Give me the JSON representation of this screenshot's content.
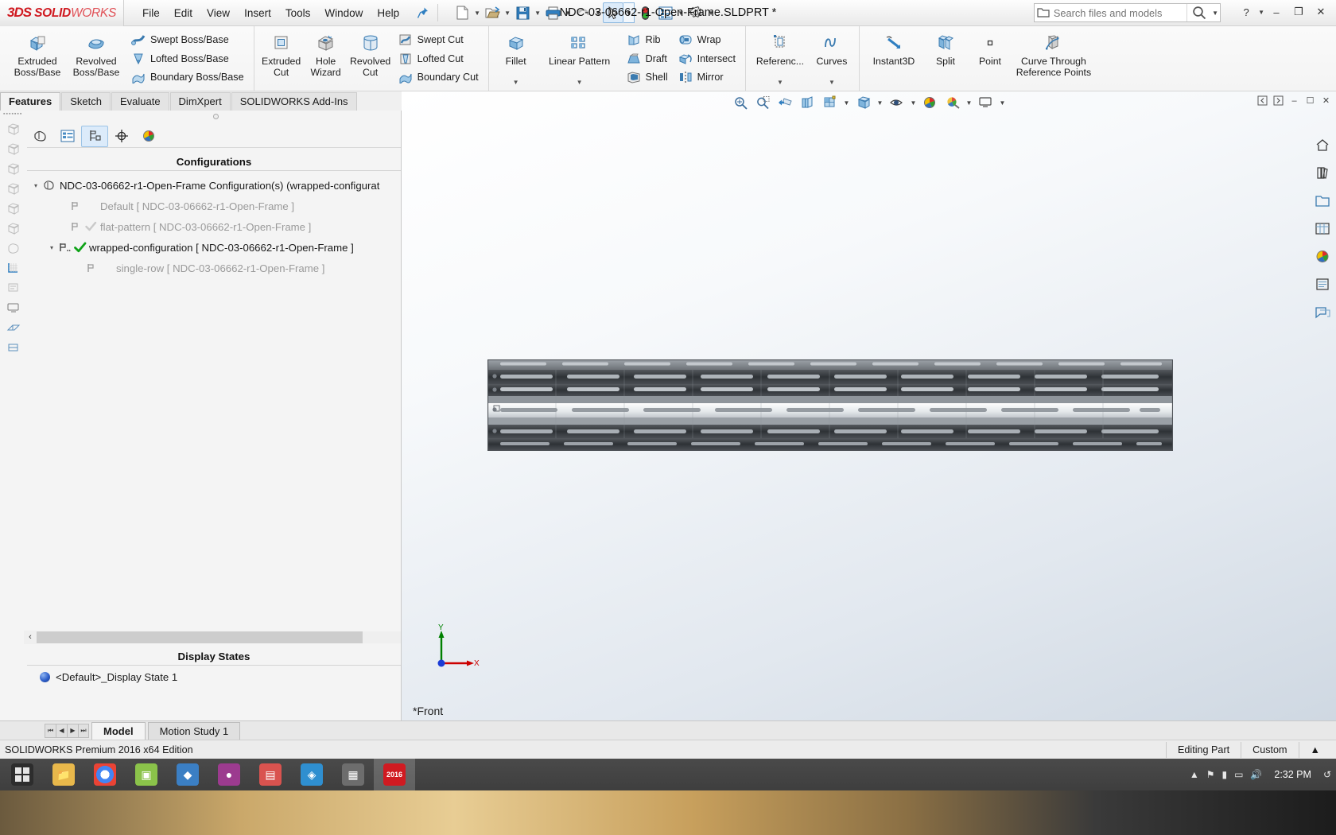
{
  "titlebar": {
    "logo_ds": "3DS",
    "logo_solid": "SOLID",
    "logo_works": "WORKS",
    "menu": [
      "File",
      "Edit",
      "View",
      "Insert",
      "Tools",
      "Window",
      "Help"
    ],
    "document_title": "NDC-03-06662-r1-Open-Frame.SLDPRT *",
    "quick_access": [
      {
        "name": "pin-icon",
        "label": "Pin"
      },
      {
        "name": "new-document-icon",
        "label": "New"
      },
      {
        "name": "open-document-icon",
        "label": "Open"
      },
      {
        "name": "save-icon",
        "label": "Save"
      },
      {
        "name": "print-icon",
        "label": "Print"
      },
      {
        "name": "undo-icon",
        "label": "Undo"
      },
      {
        "name": "select-cursor-icon",
        "label": "Select"
      },
      {
        "name": "rebuild-icon",
        "label": "Rebuild"
      },
      {
        "name": "options-list-icon",
        "label": "File Properties"
      },
      {
        "name": "gear-icon",
        "label": "Options"
      }
    ],
    "search": {
      "placeholder": "Search files and models",
      "folder_icon": "folder-icon",
      "go_icon": "search-icon"
    },
    "window_controls": {
      "help": "?",
      "minimize": "–",
      "restore": "❐",
      "close": "✕"
    }
  },
  "ribbon": {
    "groups": [
      {
        "name": "boss-base",
        "big": [
          {
            "label": "Extruded\nBoss/Base",
            "icon": "extruded-boss-icon"
          },
          {
            "label": "Revolved\nBoss/Base",
            "icon": "revolved-boss-icon"
          }
        ],
        "small": [
          {
            "label": "Swept Boss/Base",
            "icon": "swept-boss-icon"
          },
          {
            "label": "Lofted Boss/Base",
            "icon": "lofted-boss-icon"
          },
          {
            "label": "Boundary Boss/Base",
            "icon": "boundary-boss-icon"
          }
        ]
      },
      {
        "name": "cut",
        "big": [
          {
            "label": "Extruded\nCut",
            "icon": "extruded-cut-icon"
          },
          {
            "label": "Hole\nWizard",
            "icon": "hole-wizard-icon"
          },
          {
            "label": "Revolved\nCut",
            "icon": "revolved-cut-icon"
          }
        ],
        "small": [
          {
            "label": "Swept Cut",
            "icon": "swept-cut-icon"
          },
          {
            "label": "Lofted Cut",
            "icon": "lofted-cut-icon"
          },
          {
            "label": "Boundary Cut",
            "icon": "boundary-cut-icon"
          }
        ]
      },
      {
        "name": "fillet-pattern",
        "big": [
          {
            "label": "Fillet",
            "icon": "fillet-icon",
            "caret": true
          },
          {
            "label": "Linear Pattern",
            "icon": "linear-pattern-icon",
            "caret": true
          }
        ],
        "small": [
          {
            "label": "Rib",
            "icon": "rib-icon"
          },
          {
            "label": "Draft",
            "icon": "draft-icon"
          },
          {
            "label": "Shell",
            "icon": "shell-icon"
          }
        ],
        "small2": [
          {
            "label": "Wrap",
            "icon": "wrap-icon"
          },
          {
            "label": "Intersect",
            "icon": "intersect-icon"
          },
          {
            "label": "Mirror",
            "icon": "mirror-icon"
          }
        ]
      },
      {
        "name": "reference-curves",
        "big": [
          {
            "label": "Referenc...",
            "icon": "reference-geometry-icon",
            "caret": true
          },
          {
            "label": "Curves",
            "icon": "curves-icon",
            "caret": true
          }
        ]
      },
      {
        "name": "instant3d",
        "big": [
          {
            "label": "Instant3D",
            "icon": "instant3d-icon"
          },
          {
            "label": "Split",
            "icon": "split-icon"
          },
          {
            "label": "Point",
            "icon": "point-icon"
          },
          {
            "label": "Curve Through\nReference Points",
            "icon": "curve-through-points-icon"
          }
        ]
      }
    ]
  },
  "command_tabs": [
    {
      "label": "Features",
      "active": true
    },
    {
      "label": "Sketch",
      "active": false
    },
    {
      "label": "Evaluate",
      "active": false
    },
    {
      "label": "DimXpert",
      "active": false
    },
    {
      "label": "SOLIDWORKS Add-Ins",
      "active": false
    }
  ],
  "feature_manager": {
    "toolbar_buttons": [
      {
        "name": "feature-manager-tree-tab",
        "active": false
      },
      {
        "name": "property-manager-tab",
        "active": false
      },
      {
        "name": "configuration-manager-tab",
        "active": true
      },
      {
        "name": "dimxpert-manager-tab",
        "active": false
      },
      {
        "name": "display-manager-tab",
        "active": false
      }
    ],
    "configurations_header": "Configurations",
    "tree": [
      {
        "label": "NDC-03-06662-r1-Open-Frame Configuration(s)  (wrapped-configurat",
        "indent": 0,
        "twist": "▾",
        "icon": "part-config-root-icon",
        "check": false,
        "dim": false
      },
      {
        "label": "Default [ NDC-03-06662-r1-Open-Frame ]",
        "indent": 1,
        "twist": "",
        "icon": "configuration-flag-icon",
        "check": false,
        "dim": true
      },
      {
        "label": "flat-pattern [ NDC-03-06662-r1-Open-Frame ]",
        "indent": 1,
        "twist": "",
        "icon": "configuration-flag-icon",
        "check": true,
        "check_dim": true,
        "dim": true
      },
      {
        "label": "wrapped-configuration [ NDC-03-06662-r1-Open-Frame ]",
        "indent": 1,
        "twist": "▾",
        "icon": "derived-configuration-icon",
        "check": true,
        "dim": false
      },
      {
        "label": "single-row [ NDC-03-06662-r1-Open-Frame ]",
        "indent": 2,
        "twist": "",
        "icon": "configuration-flag-icon",
        "check": false,
        "dim": true
      }
    ],
    "display_states_header": "Display States",
    "display_states": [
      {
        "label": "<Default>_Display State 1",
        "icon": "display-state-sphere-icon"
      }
    ],
    "scrollbar": {
      "left_arrow": "‹",
      "right_arrow": "›"
    }
  },
  "graphics": {
    "heads_up_toolbar": [
      {
        "name": "zoom-to-fit-icon"
      },
      {
        "name": "zoom-to-area-icon"
      },
      {
        "name": "previous-view-icon"
      },
      {
        "name": "section-view-icon"
      },
      {
        "name": "view-orientation-icon",
        "caret": true
      },
      {
        "name": "display-style-icon",
        "caret": true
      },
      {
        "name": "hide-show-items-icon",
        "caret": true
      },
      {
        "name": "edit-appearance-icon"
      },
      {
        "name": "apply-scene-icon",
        "caret": true
      },
      {
        "name": "view-settings-icon",
        "caret": true
      }
    ],
    "window_buttons": [
      {
        "name": "panel-collapse-left-icon"
      },
      {
        "name": "panel-expand-right-icon"
      },
      {
        "name": "minimize-doc-icon"
      },
      {
        "name": "restore-doc-icon"
      },
      {
        "name": "close-doc-icon"
      }
    ],
    "right_rail": [
      {
        "name": "home-icon"
      },
      {
        "name": "design-library-icon"
      },
      {
        "name": "file-explorer-icon"
      },
      {
        "name": "view-palette-icon"
      },
      {
        "name": "appearances-scenes-icon"
      },
      {
        "name": "custom-properties-icon"
      },
      {
        "name": "solidworks-forum-icon"
      }
    ],
    "view_label": "*Front",
    "triad": {
      "x_label": "X",
      "y_label": "Y"
    }
  },
  "document_tabs": {
    "nav": [
      "⏮",
      "◀",
      "▶",
      "⏭"
    ],
    "tabs": [
      {
        "label": "Model",
        "active": true
      },
      {
        "label": "Motion Study 1",
        "active": false
      }
    ]
  },
  "statusbar": {
    "left": "SOLIDWORKS Premium 2016 x64 Edition",
    "editing": "Editing Part",
    "units": "Custom",
    "caret": "▲"
  },
  "taskbar": {
    "items": [
      {
        "name": "start-windows-icon",
        "glyph": "⊞",
        "color": "#2d2d2d"
      },
      {
        "name": "file-explorer-taskbar-icon",
        "glyph": "🗀",
        "color": "#e8b84b"
      },
      {
        "name": "chrome-taskbar-icon",
        "glyph": "◉",
        "color": "#4285f4"
      },
      {
        "name": "app4-taskbar-icon",
        "glyph": "▣",
        "color": "#8bc34a"
      },
      {
        "name": "app5-taskbar-icon",
        "glyph": "◆",
        "color": "#3b7fc4"
      },
      {
        "name": "app6-taskbar-icon",
        "glyph": "●",
        "color": "#9c3b8f"
      },
      {
        "name": "app7-taskbar-icon",
        "glyph": "▤",
        "color": "#d9534f"
      },
      {
        "name": "app8-taskbar-icon",
        "glyph": "◈",
        "color": "#2f8fd0"
      },
      {
        "name": "app9-taskbar-icon",
        "glyph": "▦",
        "color": "#6d6d6d"
      },
      {
        "name": "solidworks-taskbar-icon",
        "glyph": "2016",
        "color": "#d01a21",
        "active": true
      }
    ],
    "tray": [
      {
        "name": "tray-expand-icon",
        "glyph": "▲"
      },
      {
        "name": "tray-flag-icon",
        "glyph": "⚑"
      },
      {
        "name": "tray-battery-icon",
        "glyph": "▮"
      },
      {
        "name": "tray-network-icon",
        "glyph": "▭"
      },
      {
        "name": "tray-volume-icon",
        "glyph": "🔊"
      },
      {
        "name": "tray-share-icon",
        "glyph": "↺"
      }
    ],
    "clock": "2:32 PM",
    "notification_icon": "notification-bell-icon"
  },
  "colors": {
    "brand_red": "#d01a21",
    "accent_blue": "#2d5ec9",
    "check_green": "#0fa318",
    "axis_x_red": "#cc0000",
    "axis_y_green": "#008000",
    "panel_bg": "#f4f4f4"
  }
}
